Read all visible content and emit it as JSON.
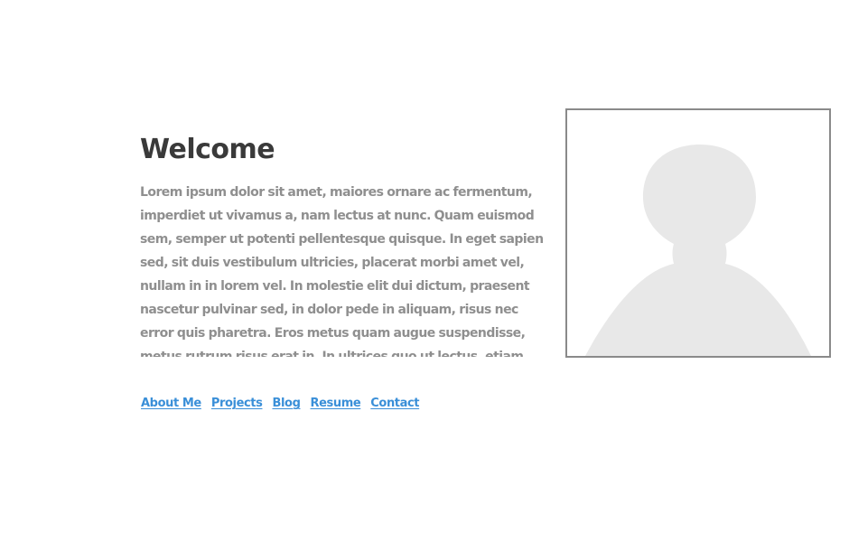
{
  "header": {
    "title": "Welcome"
  },
  "intro": {
    "text": "Lorem ipsum dolor sit amet, maiores ornare ac fermentum, imperdiet ut vivamus a, nam lectus at nunc. Quam euismod sem, semper ut potenti pellentesque quisque. In eget sapien sed, sit duis vestibulum ultricies, placerat morbi amet vel, nullam in in lorem vel. In molestie elit dui dictum, praesent nascetur pulvinar sed, in dolor pede in aliquam, risus nec error quis pharetra. Eros metus quam augue suspendisse, metus rutrum risus erat in. In ultrices quo ut lectus, etiam vestibulum"
  },
  "avatar": {
    "icon": "person-placeholder-icon",
    "fill_color": "#e8e8e8",
    "border_color": "#8a8a8a"
  },
  "nav": {
    "link_color": "#3a8fd8",
    "items": [
      {
        "label": "About Me"
      },
      {
        "label": "Projects"
      },
      {
        "label": "Blog"
      },
      {
        "label": "Resume"
      },
      {
        "label": "Contact"
      }
    ]
  }
}
